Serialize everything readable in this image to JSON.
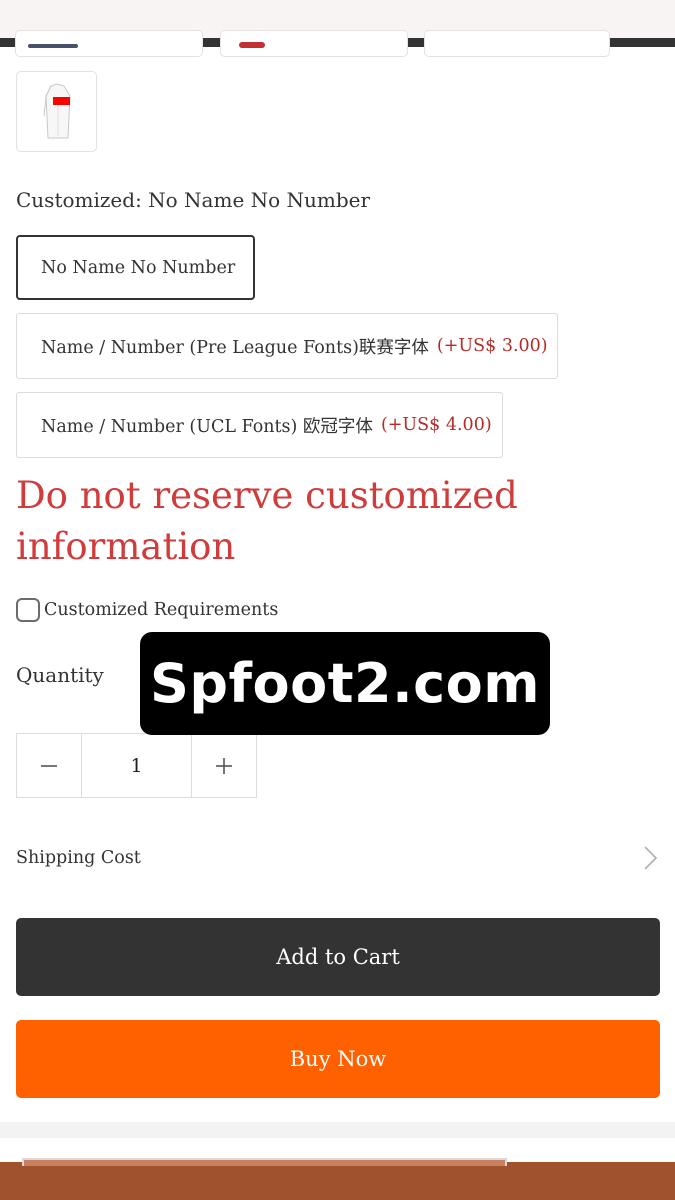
{
  "product_options": {
    "title": "Customized: No Name No Number",
    "options": [
      {
        "label": "No Name No Number",
        "price": "",
        "selected": true
      },
      {
        "label": "Name / Number (Pre League Fonts)联赛字体",
        "price": "(+US$ 3.00)",
        "selected": false
      },
      {
        "label": "Name / Number (UCL Fonts) 欧冠字体",
        "price": "(+US$ 4.00)",
        "selected": false
      }
    ]
  },
  "warning": {
    "text": "Do not reserve customized information"
  },
  "customization": {
    "checkbox_label": "Customized Requirements",
    "checked": false
  },
  "quantity": {
    "label": "Quantity",
    "value": "1",
    "decrement_icon": "minus-icon",
    "increment_icon": "plus-icon"
  },
  "watermark": {
    "text": "Spfoot2.com"
  },
  "shipping": {
    "label": "Shipping Cost",
    "icon": "chevron-right-icon"
  },
  "actions": {
    "add_to_cart": "Add to Cart",
    "buy_now": "Buy Now"
  },
  "colors": {
    "primary_dark": "#333333",
    "buy_now_orange": "#ff6000",
    "warning_red": "#d03c3c",
    "price_red": "#b52b26",
    "banner_brown": "#a0522d"
  }
}
